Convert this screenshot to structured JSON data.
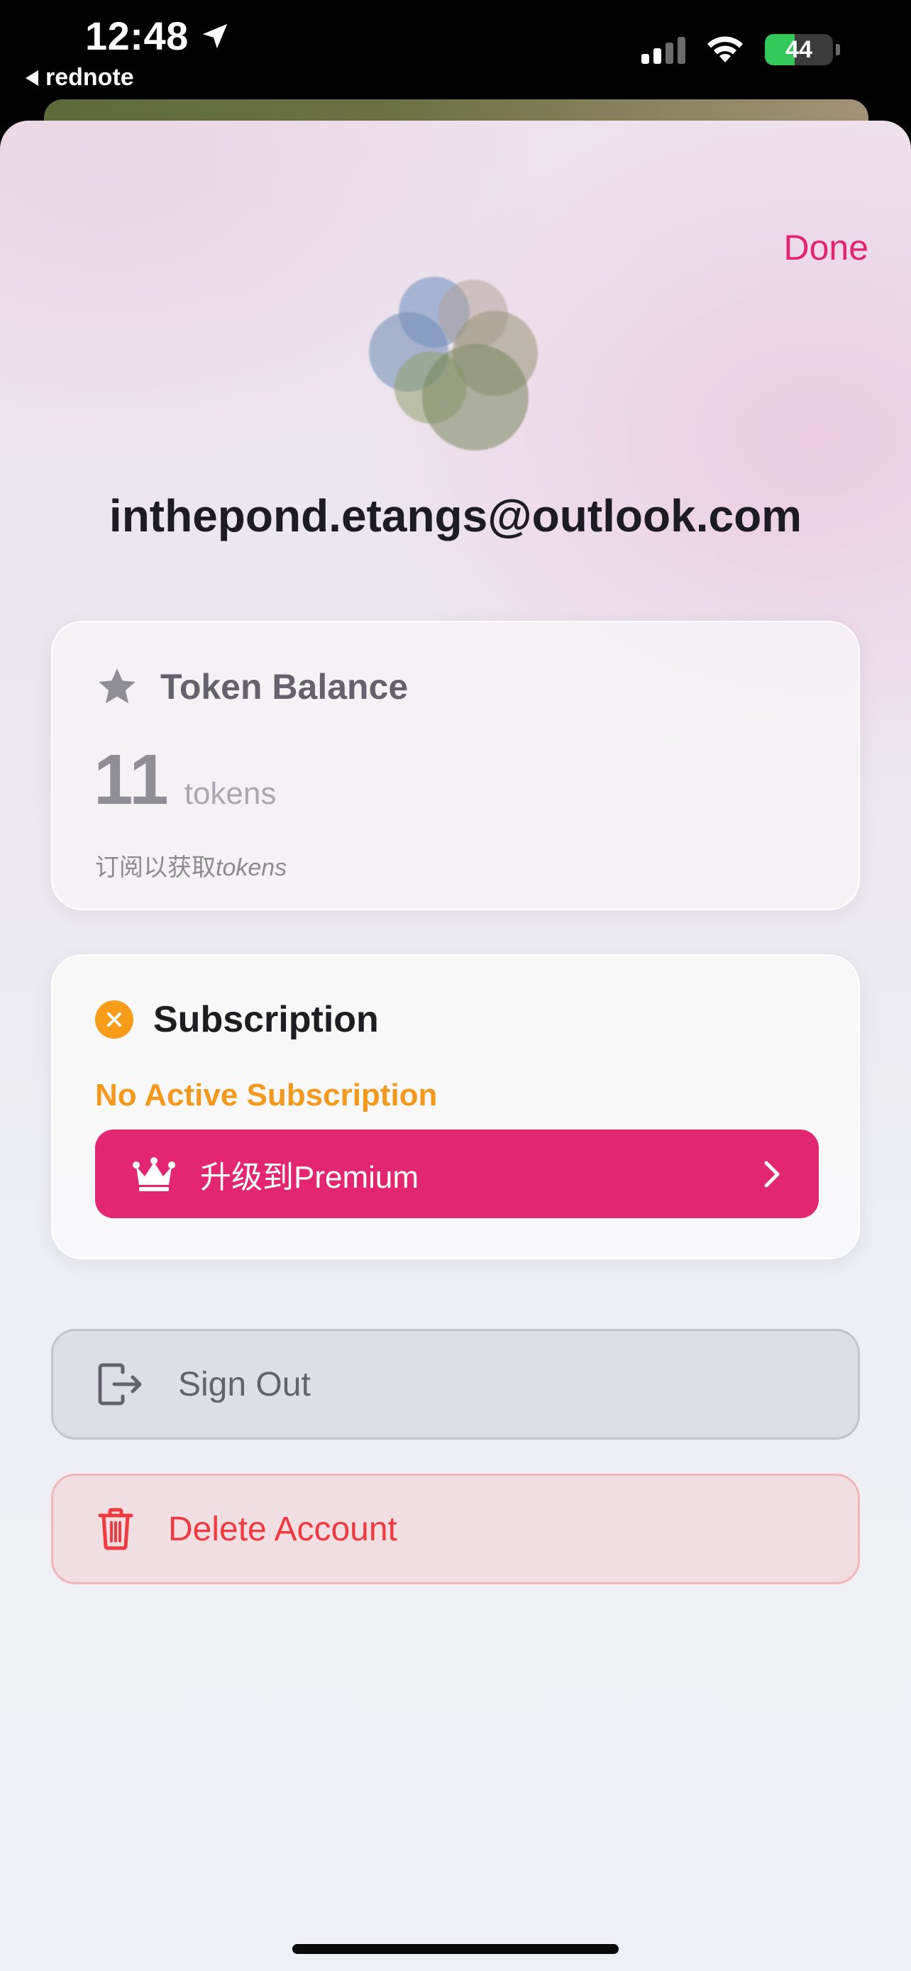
{
  "status_bar": {
    "time": "12:48",
    "back_app": "rednote",
    "battery": "44",
    "battery_level": 0.44
  },
  "header": {
    "done_label": "Done"
  },
  "profile": {
    "email": "inthepond.etangs@outlook.com"
  },
  "token_card": {
    "title": "Token Balance",
    "amount": "11",
    "unit": "tokens",
    "note_prefix": "订阅以获取",
    "note_suffix": "tokens"
  },
  "subscription_card": {
    "title": "Subscription",
    "status": "No Active Subscription",
    "upgrade_label": "升级到Premium"
  },
  "actions": {
    "sign_out": "Sign Out",
    "delete_account": "Delete Account"
  },
  "colors": {
    "accent": "#e2266f",
    "warning": "#f39a1e",
    "danger": "#ef3a3f"
  }
}
